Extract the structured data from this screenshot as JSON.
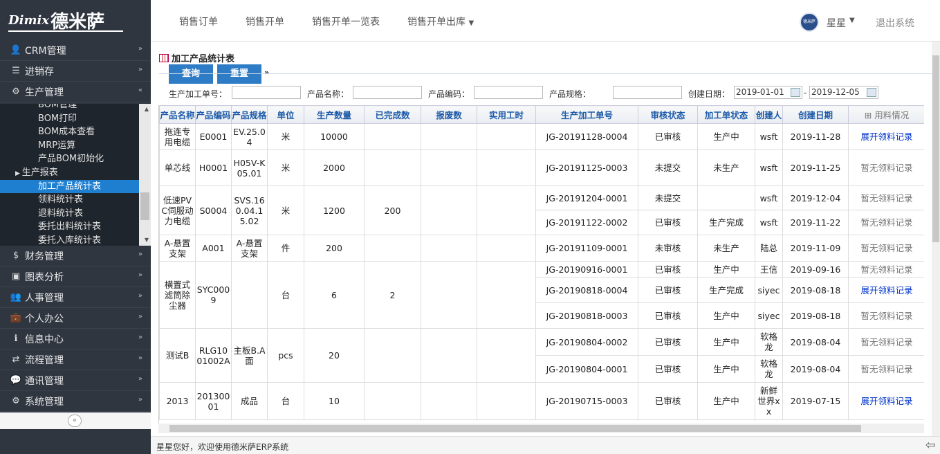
{
  "brand": {
    "en": "Dimix",
    "cn": "德米萨"
  },
  "sidebar": {
    "items_top": [
      {
        "icon": "user-icon",
        "glyph": "👤",
        "label": "CRM管理",
        "chev": "»"
      },
      {
        "icon": "list-icon",
        "glyph": "☰",
        "label": "进销存",
        "chev": "»"
      },
      {
        "icon": "gears-icon",
        "glyph": "⚙",
        "label": "生产管理",
        "chev": "«"
      }
    ],
    "submenu": [
      "BOM管理",
      "BOM打印",
      "BOM成本查看",
      "MRP运算",
      "产品BOM初始化",
      "生产报表",
      "加工产品统计表",
      "领料统计表",
      "退料统计表",
      "委托出料统计表",
      "委托入库统计表"
    ],
    "items_bottom": [
      {
        "icon": "dollar-icon",
        "glyph": "$",
        "label": "财务管理",
        "chev": "»"
      },
      {
        "icon": "image-icon",
        "glyph": "▣",
        "label": "图表分析",
        "chev": "»"
      },
      {
        "icon": "people-icon",
        "glyph": "👥",
        "label": "人事管理",
        "chev": "»"
      },
      {
        "icon": "briefcase-icon",
        "glyph": "💼",
        "label": "个人办公",
        "chev": "»"
      },
      {
        "icon": "info-icon",
        "glyph": "ℹ",
        "label": "信息中心",
        "chev": "»"
      },
      {
        "icon": "flow-icon",
        "glyph": "⇄",
        "label": "流程管理",
        "chev": "»"
      },
      {
        "icon": "chat-icon",
        "glyph": "💬",
        "label": "通讯管理",
        "chev": "»"
      },
      {
        "icon": "settings-icon",
        "glyph": "⚙",
        "label": "系统管理",
        "chev": "»"
      }
    ],
    "collapse": "«"
  },
  "topnav": [
    "销售订单",
    "销售开单",
    "销售开单一览表",
    "销售开单出库"
  ],
  "user": {
    "name": "星星",
    "avatar_text": "德米萨",
    "logout": "退出系统"
  },
  "panel": {
    "title": "加工产品统计表",
    "query": "查询",
    "reset": "重置",
    "arrow": "»"
  },
  "filters": {
    "order_label": "生产加工单号：",
    "name_label": "产品名称：",
    "code_label": "产品编码：",
    "spec_label": "产品规格：",
    "date_label": "创建日期：",
    "date_from": "2019-01-01",
    "date_sep": "-",
    "date_to": "2019-12-05"
  },
  "table": {
    "headers": [
      "产品名称",
      "产品编码",
      "产品规格",
      "单位",
      "生产数量",
      "已完成数",
      "报废数",
      "实用工时",
      "生产加工单号",
      "审核状态",
      "加工单状态",
      "创建人",
      "创建日期",
      "用料情况"
    ],
    "rows": [
      {
        "h": 38,
        "product": {
          "name": "拖连专用电缆",
          "code": "E0001",
          "spec": "EV.25.04",
          "unit": "米",
          "qty": "10000",
          "done": "",
          "scrap": "",
          "hours": "",
          "span": 1
        },
        "order": "JG-20191128-0004",
        "audit": "已审核",
        "status": "生产中",
        "creator": "wsft",
        "date": "2019-11-28",
        "usage": "展开领料记录",
        "usage_link": true
      },
      {
        "h": 52,
        "product": {
          "name": "单芯线",
          "code": "H0001",
          "spec": "H05V-K 05.01",
          "unit": "米",
          "qty": "2000",
          "done": "",
          "scrap": "",
          "hours": "",
          "span": 1
        },
        "order": "JG-20191125-0003",
        "audit": "未提交",
        "status": "未生产",
        "creator": "wsft",
        "date": "2019-11-25",
        "usage": "暂无领料记录",
        "usage_link": false
      },
      {
        "h": 35,
        "product": {
          "name": "低速PVC伺服动力电缆",
          "code": "S0004",
          "spec": "SVS.160.04.15.02",
          "unit": "米",
          "qty": "1200",
          "done": "200",
          "scrap": "",
          "hours": "",
          "span": 2
        },
        "order": "JG-20191204-0001",
        "audit": "未提交",
        "status": "",
        "creator": "wsft",
        "date": "2019-12-04",
        "usage": "暂无领料记录",
        "usage_link": false
      },
      {
        "h": 36,
        "product": null,
        "order": "JG-20191122-0002",
        "audit": "已审核",
        "status": "生产完成",
        "creator": "wsft",
        "date": "2019-11-22",
        "usage": "暂无领料记录",
        "usage_link": false
      },
      {
        "h": 38,
        "product": {
          "name": "A-悬置支架",
          "code": "A001",
          "spec": "A-悬置支架",
          "unit": "件",
          "qty": "200",
          "done": "",
          "scrap": "",
          "hours": "",
          "span": 1
        },
        "order": "JG-20191109-0001",
        "audit": "未审核",
        "status": "未生产",
        "creator": "陆总",
        "date": "2019-11-09",
        "usage": "暂无领料记录",
        "usage_link": false
      },
      {
        "h": 23,
        "product": {
          "name": "横置式滤筒除尘器",
          "code": "SYC0009",
          "spec": "",
          "unit": "台",
          "qty": "6",
          "done": "2",
          "scrap": "",
          "hours": "",
          "span": 3
        },
        "order": "JG-20190916-0001",
        "audit": "已审核",
        "status": "生产中",
        "creator": "王信",
        "date": "2019-09-16",
        "usage": "暂无领料记录",
        "usage_link": false
      },
      {
        "h": 37,
        "product": null,
        "order": "JG-20190818-0004",
        "audit": "已审核",
        "status": "生产完成",
        "creator": "siyec",
        "date": "2019-08-18",
        "usage": "展开领料记录",
        "usage_link": true
      },
      {
        "h": 37,
        "product": null,
        "order": "JG-20190818-0003",
        "audit": "已审核",
        "status": "生产中",
        "creator": "siyec",
        "date": "2019-08-18",
        "usage": "暂无领料记录",
        "usage_link": false
      },
      {
        "h": 39,
        "product": {
          "name": "测试B",
          "code": "RLG1001002A",
          "spec": "主板B.A面",
          "unit": "pcs",
          "qty": "20",
          "done": "",
          "scrap": "",
          "hours": "",
          "span": 2
        },
        "order": "JG-20190804-0002",
        "audit": "已审核",
        "status": "生产中",
        "creator": "软格龙",
        "date": "2019-08-04",
        "usage": "暂无领料记录",
        "usage_link": false
      },
      {
        "h": 39,
        "product": null,
        "order": "JG-20190804-0001",
        "audit": "已审核",
        "status": "生产中",
        "creator": "软格龙",
        "date": "2019-08-04",
        "usage": "暂无领料记录",
        "usage_link": false
      },
      {
        "h": 54,
        "product": {
          "name": "2013",
          "code": "20130001",
          "spec": "成品",
          "unit": "台",
          "qty": "10",
          "done": "",
          "scrap": "",
          "hours": "",
          "span": 1
        },
        "order": "JG-20190715-0003",
        "audit": "已审核",
        "status": "生产中",
        "creator": "新鲜世界xx",
        "date": "2019-07-15",
        "usage": "展开领料记录",
        "usage_link": true
      }
    ]
  },
  "footer": {
    "text": "星星您好，欢迎使用德米萨ERP系统"
  }
}
